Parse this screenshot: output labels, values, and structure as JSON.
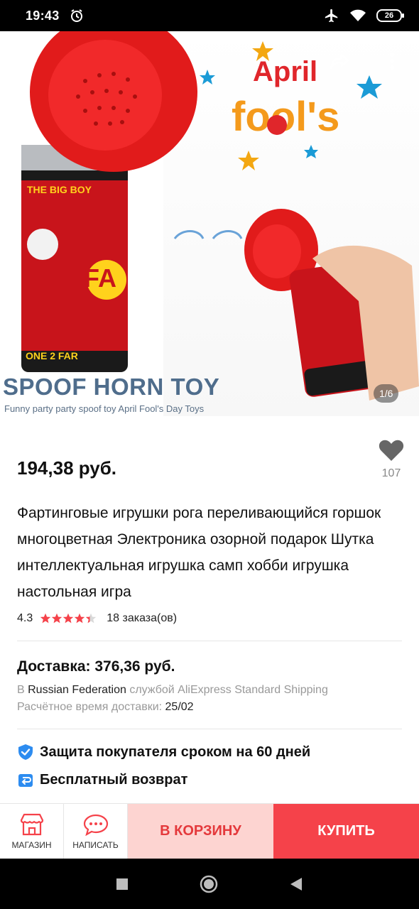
{
  "status_bar": {
    "time": "19:43",
    "battery": "26"
  },
  "gallery": {
    "counter": "1/6",
    "headline": "SPOOF HORN TOY",
    "subline": "Funny party party spoof toy April Fool's Day Toys",
    "badge_line1": "April",
    "badge_line2": "fool's",
    "can_label_top": "THE BIG BOY",
    "can_label_bottom": "ONE 2 FAR"
  },
  "product": {
    "price": "194,38 руб.",
    "favorites_count": "107",
    "title": "Фартинговые игрушки рога переливающийся горшок многоцветная Электроника озорной подарок Шутка интеллектуальная игрушка самп хобби игрушка настольная игра",
    "rating": "4.3",
    "rating_stars": 4.3,
    "orders": "18 заказа(ов)"
  },
  "delivery": {
    "title": "Доставка: 376,36 руб.",
    "prefix": "В ",
    "country": "Russian Federation",
    "service": " службой AliExpress Standard Shipping",
    "eta_label": "Расчётное время доставки: ",
    "eta_date": "25/02"
  },
  "perks": {
    "protection": "Защита покупателя сроком на 60 дней",
    "returns": "Бесплатный возврат"
  },
  "action_bar": {
    "store_label": "МАГАЗИН",
    "message_label": "НАПИСАТЬ",
    "cart_label": "В КОРЗИНУ",
    "buy_label": "КУПИТЬ"
  },
  "colors": {
    "accent_red": "#f5424a",
    "cart_bg": "#fdd4d1",
    "star": "#f5424a",
    "shield_blue": "#2d8cf0"
  },
  "icons": [
    "back-arrow-icon",
    "share-icon",
    "more-icon",
    "heart-icon",
    "star-icon",
    "shield-icon",
    "return-box-icon",
    "store-icon",
    "chat-icon",
    "nav-recents-icon",
    "nav-home-icon",
    "nav-back-icon",
    "alarm-icon",
    "airplane-icon",
    "wifi-icon"
  ]
}
